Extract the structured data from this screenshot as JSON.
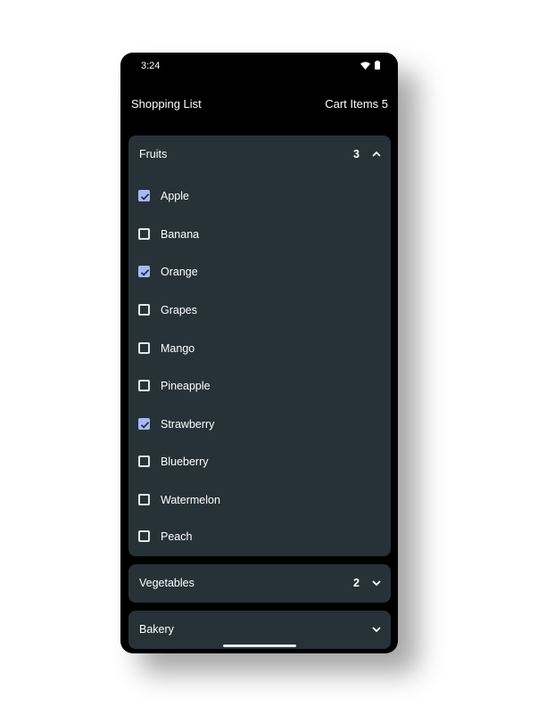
{
  "status_bar": {
    "time": "3:24"
  },
  "header": {
    "title": "Shopping List",
    "cart_label": "Cart Items 5"
  },
  "sections": [
    {
      "title": "Fruits",
      "count": "3",
      "expanded": true,
      "items": [
        {
          "label": "Apple",
          "checked": true
        },
        {
          "label": "Banana",
          "checked": false
        },
        {
          "label": "Orange",
          "checked": true
        },
        {
          "label": "Grapes",
          "checked": false
        },
        {
          "label": "Mango",
          "checked": false
        },
        {
          "label": "Pineapple",
          "checked": false
        },
        {
          "label": "Strawberry",
          "checked": true
        },
        {
          "label": "Blueberry",
          "checked": false
        },
        {
          "label": "Watermelon",
          "checked": false
        },
        {
          "label": "Peach",
          "checked": false
        }
      ]
    },
    {
      "title": "Vegetables",
      "count": "2",
      "expanded": false
    },
    {
      "title": "Bakery",
      "count": "",
      "expanded": false
    }
  ],
  "colors": {
    "background": "#000000",
    "card": "#263238",
    "checkbox_checked": "#a8b8f6",
    "text": "#ffffff"
  },
  "icons": {
    "status": [
      "wifi-icon",
      "battery-icon"
    ],
    "collapse": "chevron-up-icon",
    "expand": "chevron-down-icon",
    "check": "check-icon"
  }
}
